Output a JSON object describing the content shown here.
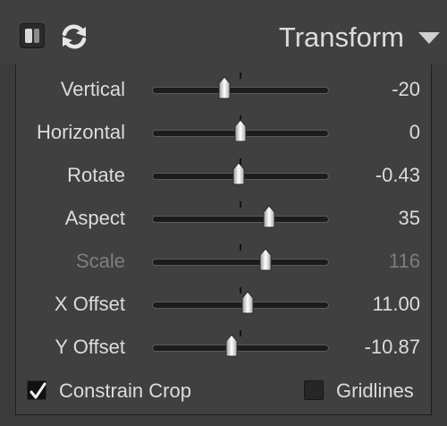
{
  "panel": {
    "title": "Transform",
    "toggle_icon": "before-after-toggle-icon",
    "reset_icon": "reset-refresh-icon",
    "collapse_icon": "triangle-down-icon"
  },
  "sliders": [
    {
      "label": "Vertical",
      "value": "-20",
      "position": 0.41,
      "enabled": true
    },
    {
      "label": "Horizontal",
      "value": "0",
      "position": 0.5,
      "enabled": true
    },
    {
      "label": "Rotate",
      "value": "-0.43",
      "position": 0.49,
      "enabled": true
    },
    {
      "label": "Aspect",
      "value": "35",
      "position": 0.66,
      "enabled": true
    },
    {
      "label": "Scale",
      "value": "116",
      "position": 0.64,
      "enabled": false
    },
    {
      "label": "X Offset",
      "value": "11.00",
      "position": 0.54,
      "enabled": true
    },
    {
      "label": "Y Offset",
      "value": "-10.87",
      "position": 0.45,
      "enabled": true
    }
  ],
  "options": {
    "constrain_crop": {
      "label": "Constrain Crop",
      "checked": true
    },
    "gridlines": {
      "label": "Gridlines",
      "checked": false
    }
  },
  "colors": {
    "background": "#3b3b3b",
    "panel": "#404040",
    "text": "#dcdcdc",
    "disabled_text": "#7e7e7e",
    "track": "#1c1c1c"
  }
}
